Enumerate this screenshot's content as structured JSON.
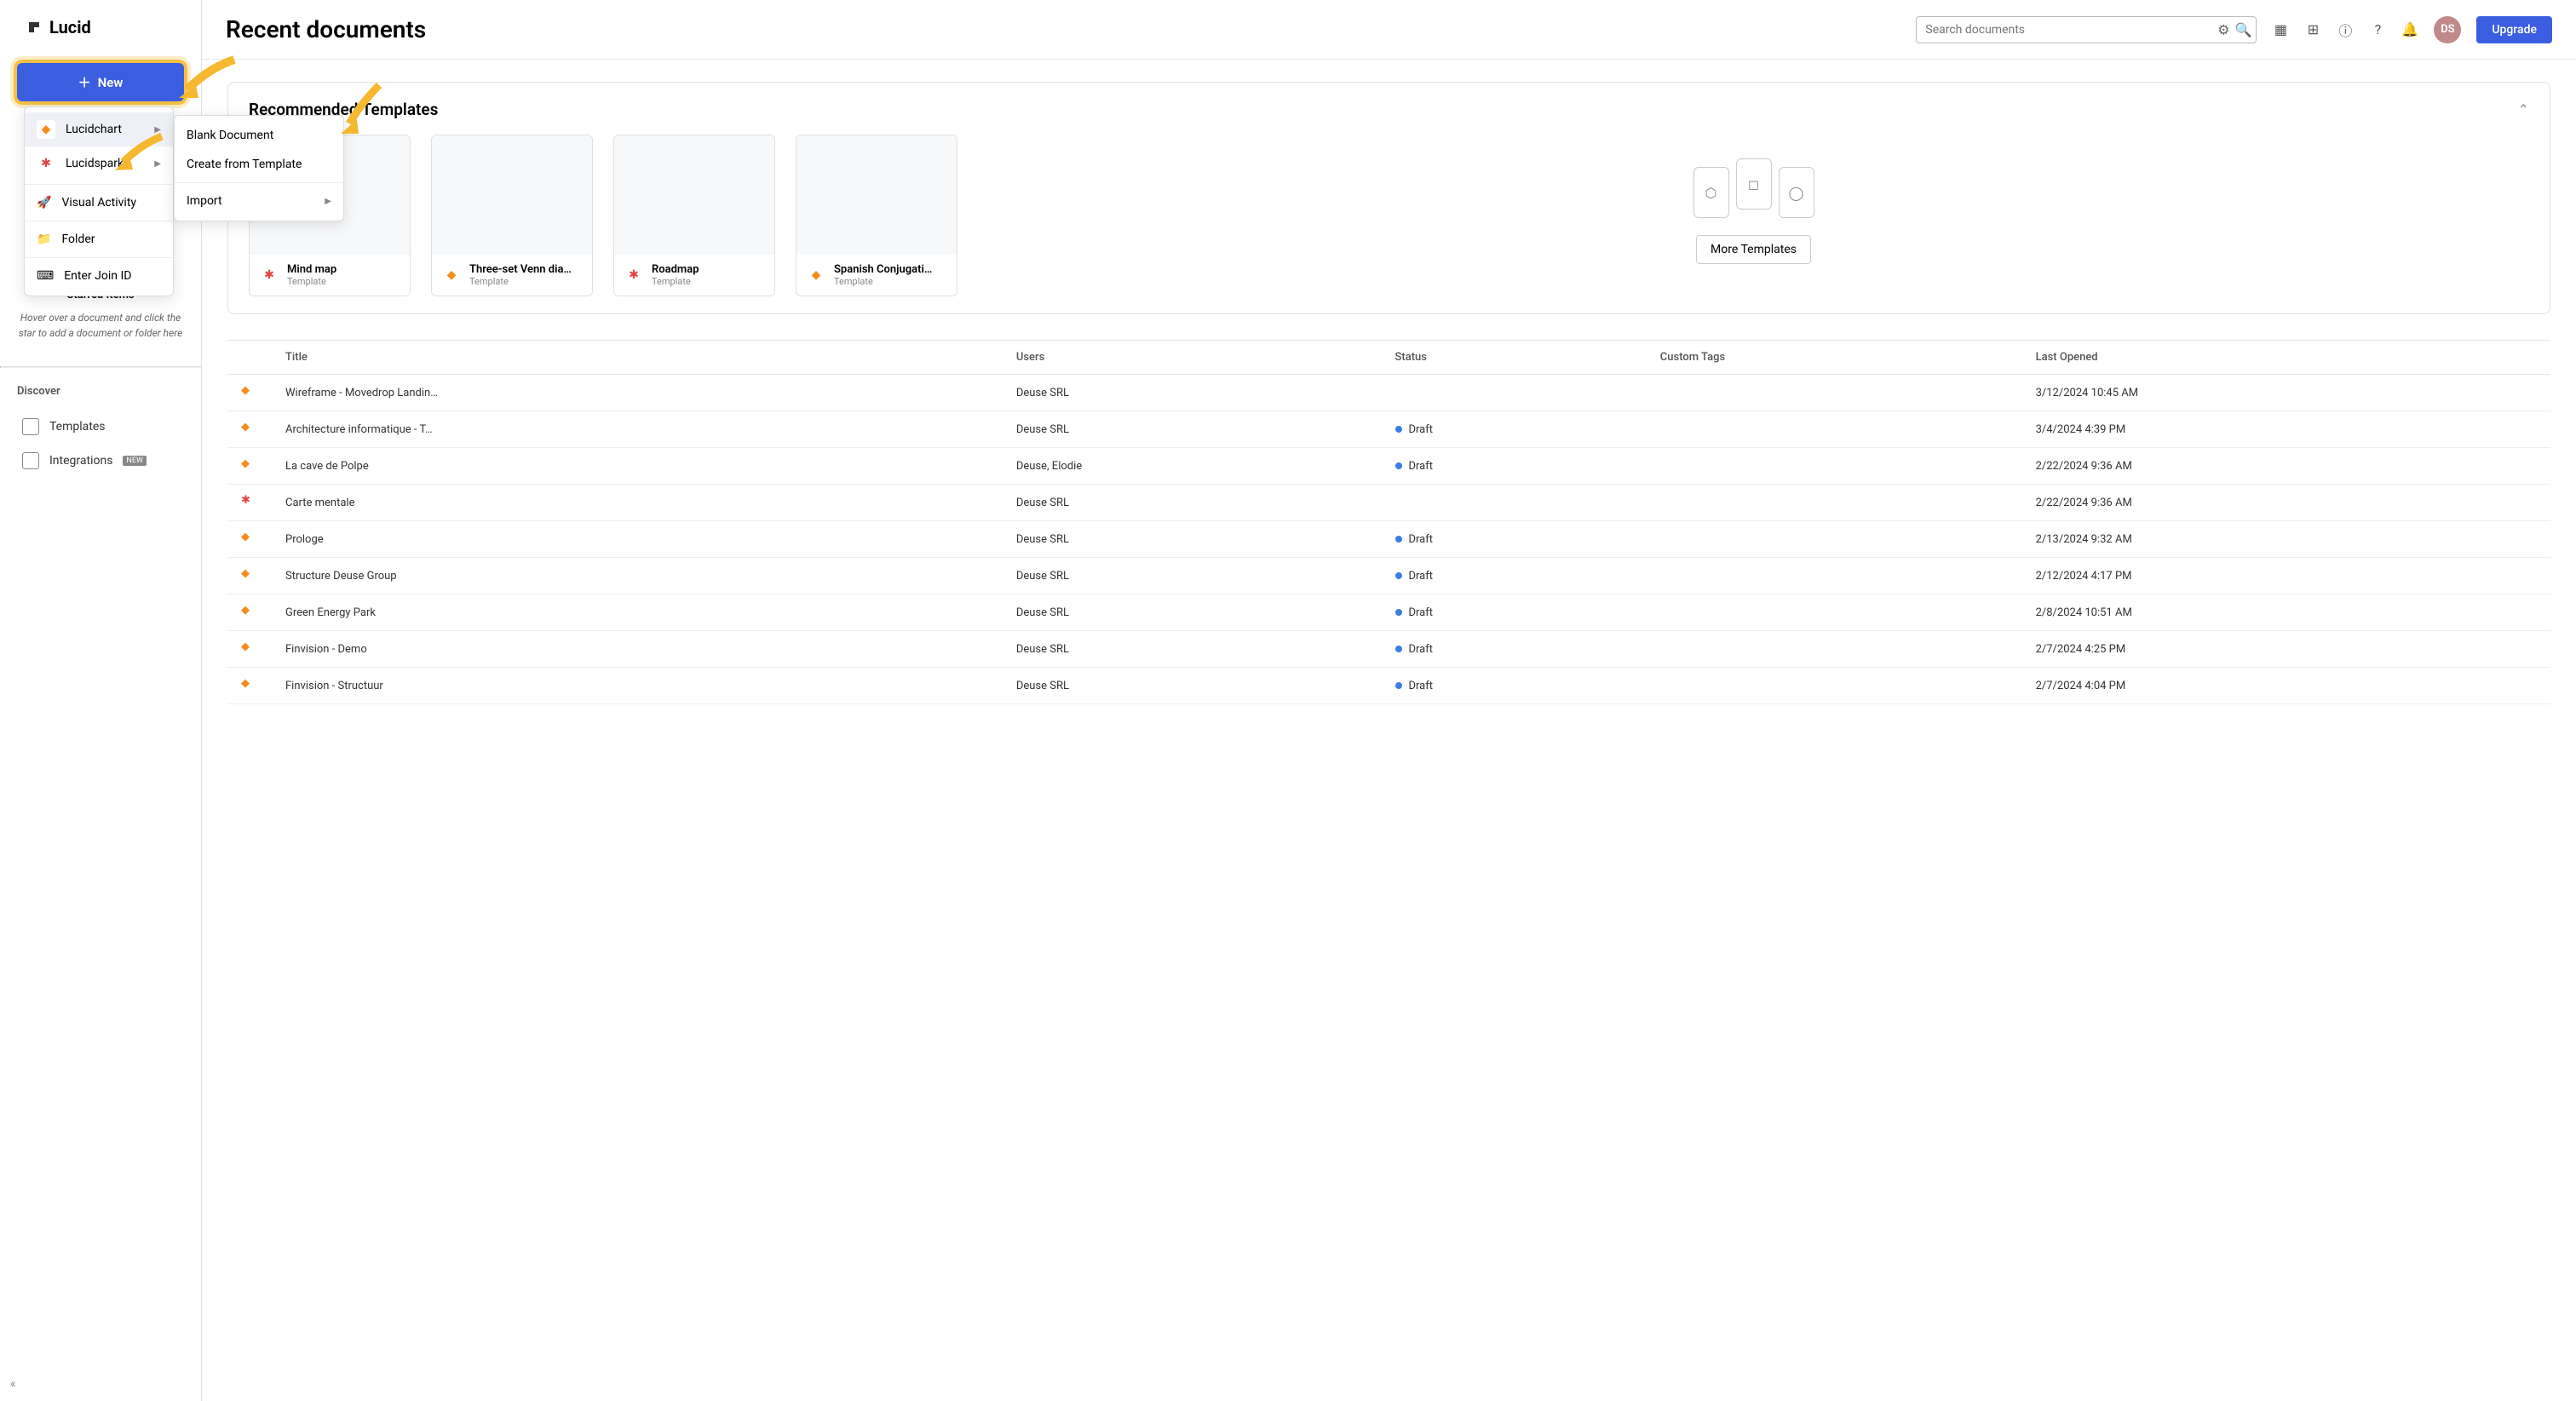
{
  "brand": "Lucid",
  "new_button": "New",
  "starred": {
    "title": "Starred Items",
    "help": "Hover over a document and click the star to add a document or folder here"
  },
  "discover": {
    "label": "Discover",
    "templates": "Templates",
    "integrations": "Integrations",
    "new_badge": "NEW"
  },
  "header": {
    "title": "Recent documents",
    "search_placeholder": "Search documents",
    "avatar": "DS",
    "upgrade": "Upgrade"
  },
  "new_menu": {
    "lucidchart": "Lucidchart",
    "lucidspark": "Lucidspark",
    "visual_activity": "Visual Activity",
    "folder": "Folder",
    "enter_join_id": "Enter Join ID"
  },
  "sub_menu": {
    "blank": "Blank Document",
    "from_template": "Create from Template",
    "import": "Import"
  },
  "reco": {
    "title": "Recommended Templates",
    "more": "More Templates",
    "template_label": "Template",
    "cards": [
      {
        "name": "Mind map",
        "chip": "red"
      },
      {
        "name": "Three-set Venn dia…",
        "chip": "orange"
      },
      {
        "name": "Roadmap",
        "chip": "red"
      },
      {
        "name": "Spanish Conjugati…",
        "chip": "orange"
      }
    ]
  },
  "table": {
    "cols": {
      "title": "Title",
      "users": "Users",
      "status": "Status",
      "tags": "Custom Tags",
      "last": "Last Opened"
    },
    "rows": [
      {
        "icon": "orange",
        "title": "Wireframe - Movedrop Landin…",
        "users": "Deuse SRL",
        "status": "",
        "last": "3/12/2024 10:45 AM"
      },
      {
        "icon": "orange",
        "title": "Architecture informatique - T…",
        "users": "Deuse SRL",
        "status": "Draft",
        "last": "3/4/2024 4:39 PM"
      },
      {
        "icon": "orange",
        "title": "La cave de Polpe",
        "users": "Deuse, Elodie",
        "status": "Draft",
        "last": "2/22/2024 9:36 AM"
      },
      {
        "icon": "red",
        "title": "Carte mentale",
        "users": "Deuse SRL",
        "status": "",
        "last": "2/22/2024 9:36 AM"
      },
      {
        "icon": "orange",
        "title": "Prologe",
        "users": "Deuse SRL",
        "status": "Draft",
        "last": "2/13/2024 9:32 AM"
      },
      {
        "icon": "orange",
        "title": "Structure Deuse Group",
        "users": "Deuse SRL",
        "status": "Draft",
        "last": "2/12/2024 4:17 PM"
      },
      {
        "icon": "orange",
        "title": "Green Energy Park",
        "users": "Deuse SRL",
        "status": "Draft",
        "last": "2/8/2024 10:51 AM"
      },
      {
        "icon": "orange",
        "title": "Finvision - Demo",
        "users": "Deuse SRL",
        "status": "Draft",
        "last": "2/7/2024 4:25 PM"
      },
      {
        "icon": "orange",
        "title": "Finvision - Structuur",
        "users": "Deuse SRL",
        "status": "Draft",
        "last": "2/7/2024 4:04 PM"
      }
    ]
  }
}
